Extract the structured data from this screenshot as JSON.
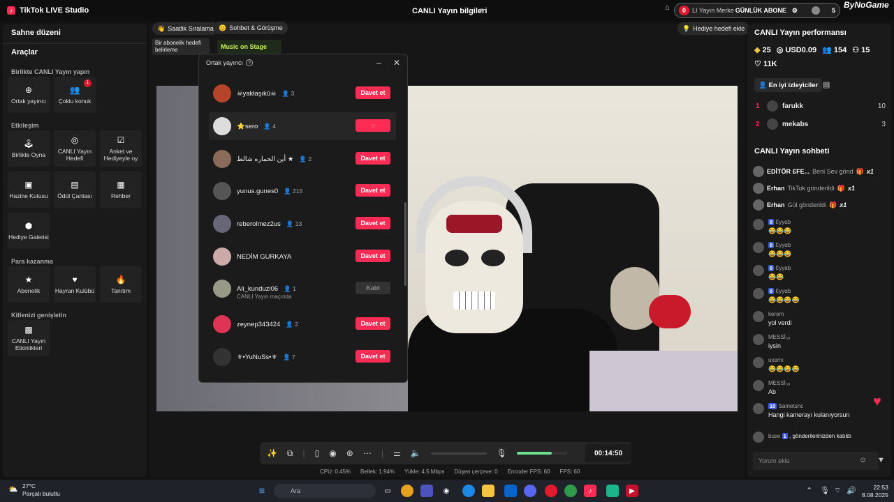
{
  "titlebar": {
    "app_title": "TikTok LIVE Studio",
    "center_title": "CANLI Yayın bilgileri",
    "center_label": "LI Yayın Merke",
    "overlay_text": "GÜNLÜK ABONE",
    "overlay_badge": "0",
    "overlay_count": "5",
    "logo": "ByNoGame"
  },
  "left": {
    "header": "Sahne düzeni",
    "tools": "Araçlar",
    "sections": [
      "Birlikte CANLI Yayın yapın",
      "Etkileşim",
      "Para kazanma",
      "Kitlenizi genişletin"
    ],
    "tiles": [
      {
        "label": "Ortak yayıncı",
        "icon": "link-icon"
      },
      {
        "label": "Çoklu konuk",
        "icon": "users-icon",
        "badge": "1"
      },
      {
        "label": "Birlikte Oyna",
        "icon": "joystick-icon"
      },
      {
        "label": "CANLI Yayın Hedefi",
        "icon": "target-icon"
      },
      {
        "label": "Anket ve Hediyeyle oy",
        "icon": "poll-icon"
      },
      {
        "label": "Hazine Kutusu",
        "icon": "chest-icon"
      },
      {
        "label": "Ödül Çantası",
        "icon": "bag-icon"
      },
      {
        "label": "Rehber",
        "icon": "book-icon"
      },
      {
        "label": "Hediye Galerisi",
        "icon": "gift-icon"
      },
      {
        "label": "Abonelik",
        "icon": "star-icon"
      },
      {
        "label": "Hayran Kulübü",
        "icon": "heart-icon"
      },
      {
        "label": "Tanıtım",
        "icon": "flame-icon"
      },
      {
        "label": "CANLI Yayın Etkinlikleri",
        "icon": "calendar-icon"
      }
    ]
  },
  "center": {
    "chips": [
      "Saatlik Sıralama",
      "Sohbet & Görüşme",
      "Hediye hedefi ekle"
    ],
    "sub_goal": "Bir abonelik hedefi belirleme",
    "music": "Music on Stage",
    "timer": "00:14:50",
    "stats": [
      "CPU: 0.45%",
      "Bellek: 1.94%",
      "Yükle: 4.5 Mbps",
      "Düşen çerçeve: 0",
      "Encoder FPS: 60",
      "FPS: 60"
    ],
    "volume_level": 0.7
  },
  "modal": {
    "title": "Ortak yayıncı",
    "rows": [
      {
        "name": "☠yakłaşıkû☠",
        "count": "3",
        "btn": "Davet et"
      },
      {
        "name": "⭐sero",
        "count": "4",
        "btn": ""
      },
      {
        "name": "أين الحماره شالط ★",
        "count": "2",
        "btn": "Davet et"
      },
      {
        "name": "yunus.gunes0",
        "count": "215",
        "btn": "Davet et"
      },
      {
        "name": "reberolmez2us",
        "count": "13",
        "btn": "Davet et"
      },
      {
        "name": "NEDİM GURKAYA",
        "count": "",
        "btn": "Davet et"
      },
      {
        "name": "Ali_kunduzi06",
        "count": "1",
        "btn": "Kabl",
        "sub": "CANLI Yayın maçında"
      },
      {
        "name": "zeynep343424",
        "count": "2",
        "btn": "Davet et"
      },
      {
        "name": "⚜•YuNuSs•⚜",
        "count": "7",
        "btn": "Davet et"
      }
    ]
  },
  "right": {
    "perf_title": "CANLI Yayın performansı",
    "perf": [
      "25",
      "USD0.09",
      "154",
      "15"
    ],
    "likes": "11K",
    "top_viewers": "En iyi izleyiciler",
    "ranks": [
      {
        "n": "1",
        "name": "farukk",
        "v": "10"
      },
      {
        "n": "2",
        "name": "mekabs",
        "v": "3"
      }
    ],
    "chat_title": "CANLI Yayın sohbeti",
    "gifts": [
      {
        "name": "EDİTÖR ƐFE...",
        "text": "Beni Sev gönd",
        "x": "x1"
      },
      {
        "name": "Erhan",
        "text": "TikTok gönderildi",
        "x": "x1"
      },
      {
        "name": "Erhan",
        "text": "Gül gönderildi",
        "x": "x1"
      }
    ],
    "chat": [
      {
        "name": "Ɛyyɑb",
        "lvl": "8",
        "text": "😂😂😂"
      },
      {
        "name": "Ɛyyɑb",
        "lvl": "8",
        "text": "😂😂😂"
      },
      {
        "name": "Ɛyyɑb",
        "lvl": "8",
        "text": "😂😂"
      },
      {
        "name": "Ɛyyɑb",
        "lvl": "8",
        "text": "😂😂😂😂"
      },
      {
        "name": "kerem",
        "lvl": "",
        "text": "yol verdi"
      },
      {
        "name": "MESSİ₃₈",
        "lvl": "",
        "text": "iysin"
      },
      {
        "name": "uxsrrx",
        "lvl": "",
        "text": "😂😂😂😂"
      },
      {
        "name": "MESSİ₃₈",
        "lvl": "",
        "text": "Ab"
      },
      {
        "name": "Sametsnc",
        "lvl": "10",
        "text": "Hangi kamerayı kulanıyorsun"
      }
    ],
    "join": {
      "name": "buse",
      "lvl": "1",
      "text": ", gönderilerinizden katıldı"
    },
    "comment_placeholder": "Yorum ekle"
  },
  "taskbar": {
    "temp": "27°C",
    "weather": "Parçalı bulutlu",
    "search": "Ara",
    "time": "22:53",
    "date": "8.08.2025"
  }
}
